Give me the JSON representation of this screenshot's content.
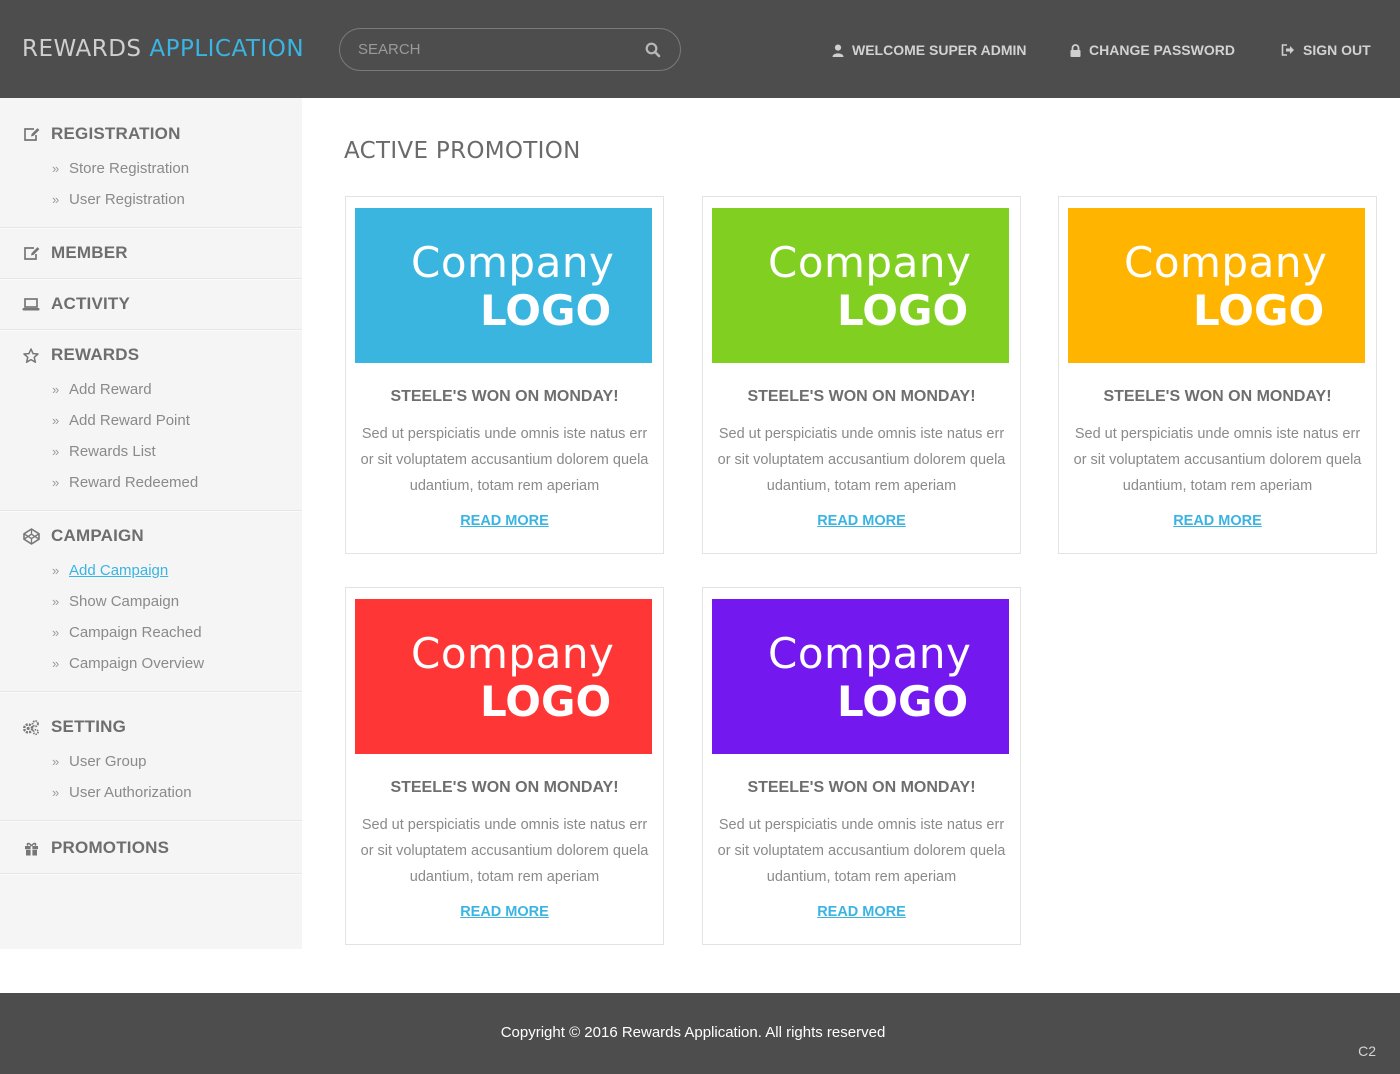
{
  "header": {
    "brand_part1": "REWARDS",
    "brand_part2": "APPLICATION",
    "search_placeholder": "SEARCH",
    "welcome": "WELCOME SUPER ADMIN",
    "change_password": "CHANGE PASSWORD",
    "sign_out": "SIGN OUT"
  },
  "sidebar": {
    "registration": {
      "label": "REGISTRATION",
      "icon": "edit-icon",
      "items": [
        "Store Registration",
        "User Registration"
      ]
    },
    "member": {
      "label": "MEMBER",
      "icon": "edit-icon"
    },
    "activity": {
      "label": "ACTIVITY",
      "icon": "laptop-icon"
    },
    "rewards": {
      "label": "REWARDS",
      "icon": "star-icon",
      "items": [
        "Add Reward",
        "Add Reward Point",
        "Rewards List",
        "Reward Redeemed"
      ]
    },
    "campaign": {
      "label": "CAMPAIGN",
      "icon": "codepen-icon",
      "items": [
        "Add Campaign",
        "Show Campaign",
        "Campaign Reached",
        "Campaign Overview"
      ]
    },
    "setting": {
      "label": "SETTING",
      "icon": "cogs-icon",
      "items": [
        "User Group",
        "User Authorization"
      ]
    },
    "promotions": {
      "label": "PROMOTIONS",
      "icon": "gift-icon"
    }
  },
  "main": {
    "title": "ACTIVE PROMOTION",
    "cards": [
      {
        "logo_line1": "Company",
        "logo_line2": "LOGO",
        "color": "#39b5e0",
        "title": "STEELE'S WON ON MONDAY!",
        "description": "Sed ut perspiciatis unde omnis iste natus err or sit voluptatem accusantium dolorem quela udantium, totam rem aperiam",
        "link": "READ MORE"
      },
      {
        "logo_line1": "Company",
        "logo_line2": "LOGO",
        "color": "#81cf20",
        "title": "STEELE'S WON ON MONDAY!",
        "description": "Sed ut perspiciatis unde omnis iste natus err or sit voluptatem accusantium dolorem quela udantium, totam rem aperiam",
        "link": "READ MORE"
      },
      {
        "logo_line1": "Company",
        "logo_line2": "LOGO",
        "color": "#ffb400",
        "title": "STEELE'S WON ON MONDAY!",
        "description": "Sed ut perspiciatis unde omnis iste natus err or sit voluptatem accusantium dolorem quela udantium, totam rem aperiam",
        "link": "READ MORE"
      },
      {
        "logo_line1": "Company",
        "logo_line2": "LOGO",
        "color": "#ff3636",
        "title": "STEELE'S WON ON MONDAY!",
        "description": "Sed ut perspiciatis unde omnis iste natus err or sit voluptatem accusantium dolorem quela udantium, totam rem aperiam",
        "link": "READ MORE"
      },
      {
        "logo_line1": "Company",
        "logo_line2": "LOGO",
        "color": "#7418f0",
        "title": "STEELE'S WON ON MONDAY!",
        "description": "Sed ut perspiciatis unde omnis iste natus err or sit voluptatem accusantium dolorem quela udantium, totam rem aperiam",
        "link": "READ MORE"
      }
    ]
  },
  "footer": {
    "copyright": "Copyright © 2016 Rewards Application. All rights reserved",
    "corner_label": "C2"
  }
}
